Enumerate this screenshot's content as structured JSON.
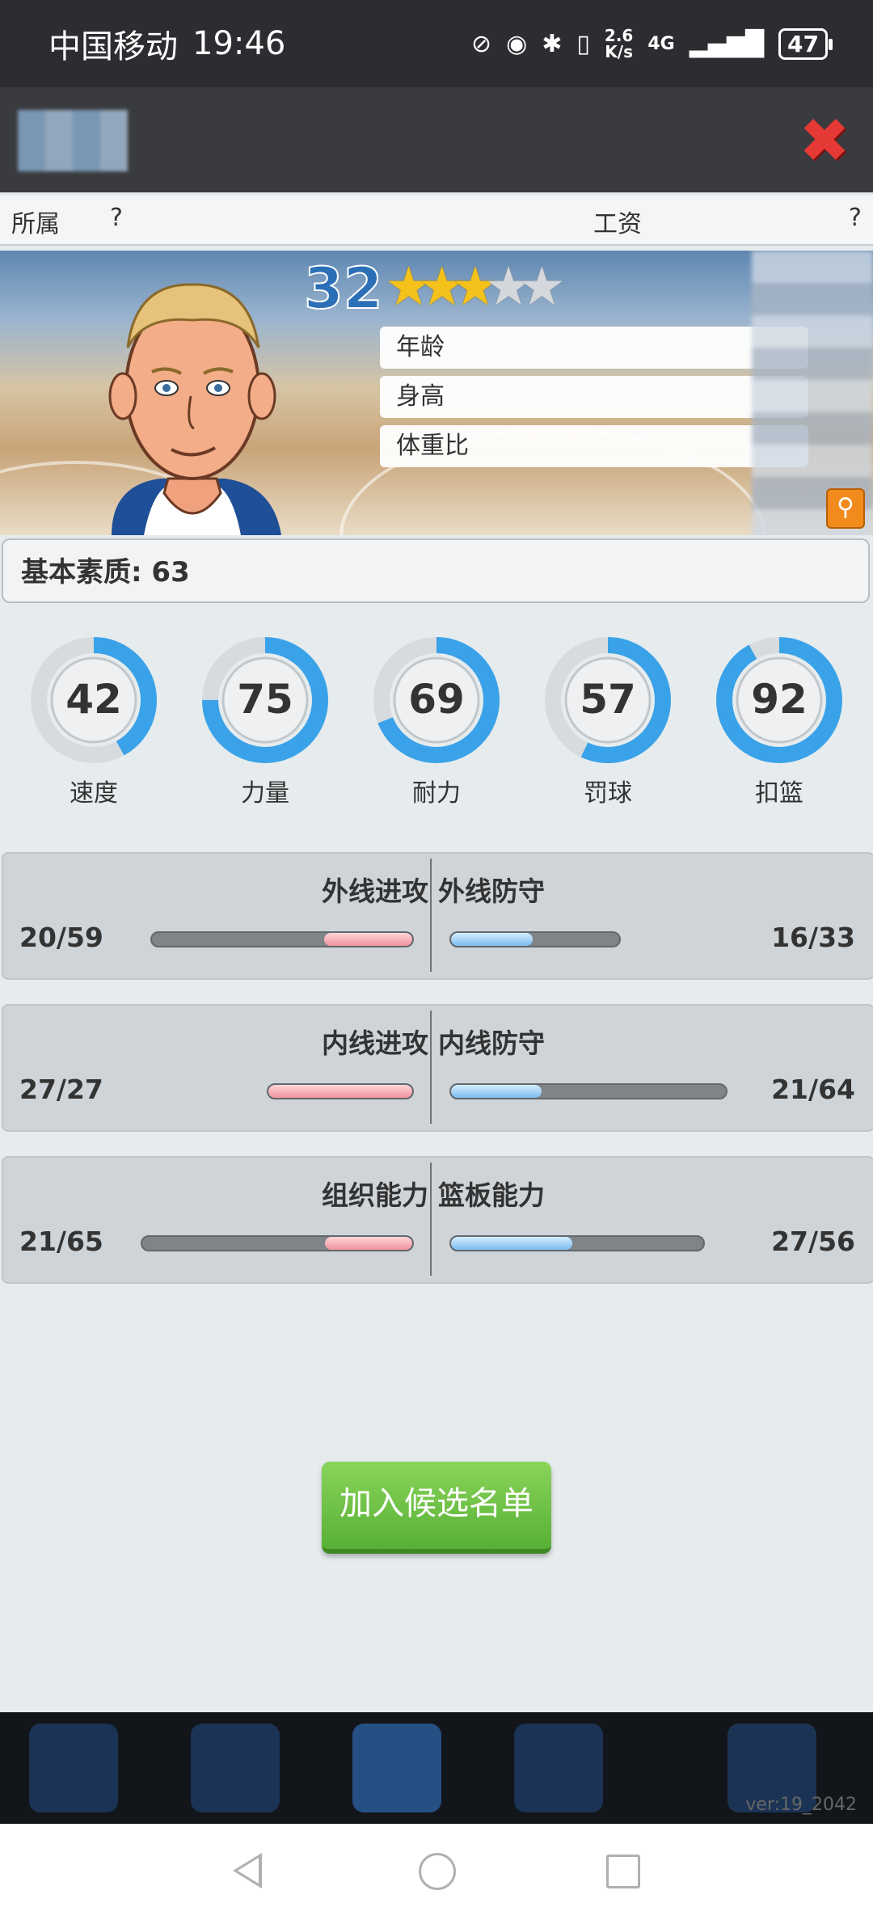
{
  "status_bar": {
    "carrier": "中国移动",
    "time": "19:46",
    "net_speed_top": "2.6",
    "net_speed_bottom": "K/s",
    "network": "4G",
    "battery": "47"
  },
  "info_row": {
    "affiliation_label": "所属",
    "affiliation_value": "?",
    "salary_label": "工资",
    "salary_value": "?"
  },
  "player": {
    "rating": "32",
    "stars_filled": 3,
    "stars_total": 5,
    "age_label": "年龄",
    "height_label": "身高",
    "weight_ratio_label": "体重比"
  },
  "basic": {
    "label": "基本素质: 63"
  },
  "gauges": [
    {
      "label": "速度",
      "value": "42",
      "fraction": 0.42
    },
    {
      "label": "力量",
      "value": "75",
      "fraction": 0.75
    },
    {
      "label": "耐力",
      "value": "69",
      "fraction": 0.69
    },
    {
      "label": "罚球",
      "value": "57",
      "fraction": 0.57
    },
    {
      "label": "扣篮",
      "value": "92",
      "fraction": 0.92
    }
  ],
  "comparisons": [
    {
      "left_title": "外线进攻",
      "left_value": "20/59",
      "left_fraction": 0.339,
      "right_title": "外线防守",
      "right_value": "16/33",
      "right_fraction": 0.485
    },
    {
      "left_title": "内线进攻",
      "left_value": "27/27",
      "left_fraction": 1.0,
      "right_title": "内线防守",
      "right_value": "21/64",
      "right_fraction": 0.328
    },
    {
      "left_title": "组织能力",
      "left_value": "21/65",
      "left_fraction": 0.323,
      "right_title": "篮板能力",
      "right_value": "27/56",
      "right_fraction": 0.482
    }
  ],
  "actions": {
    "join_button": "加入候选名单"
  },
  "footer": {
    "version": "ver:19_2042"
  },
  "colors": {
    "gauge_blue": "#3aa2e8",
    "offense_red": "#f0939a",
    "defense_blue": "#7cbcf0",
    "button_green": "#6cc244",
    "close_red": "#e53935"
  }
}
